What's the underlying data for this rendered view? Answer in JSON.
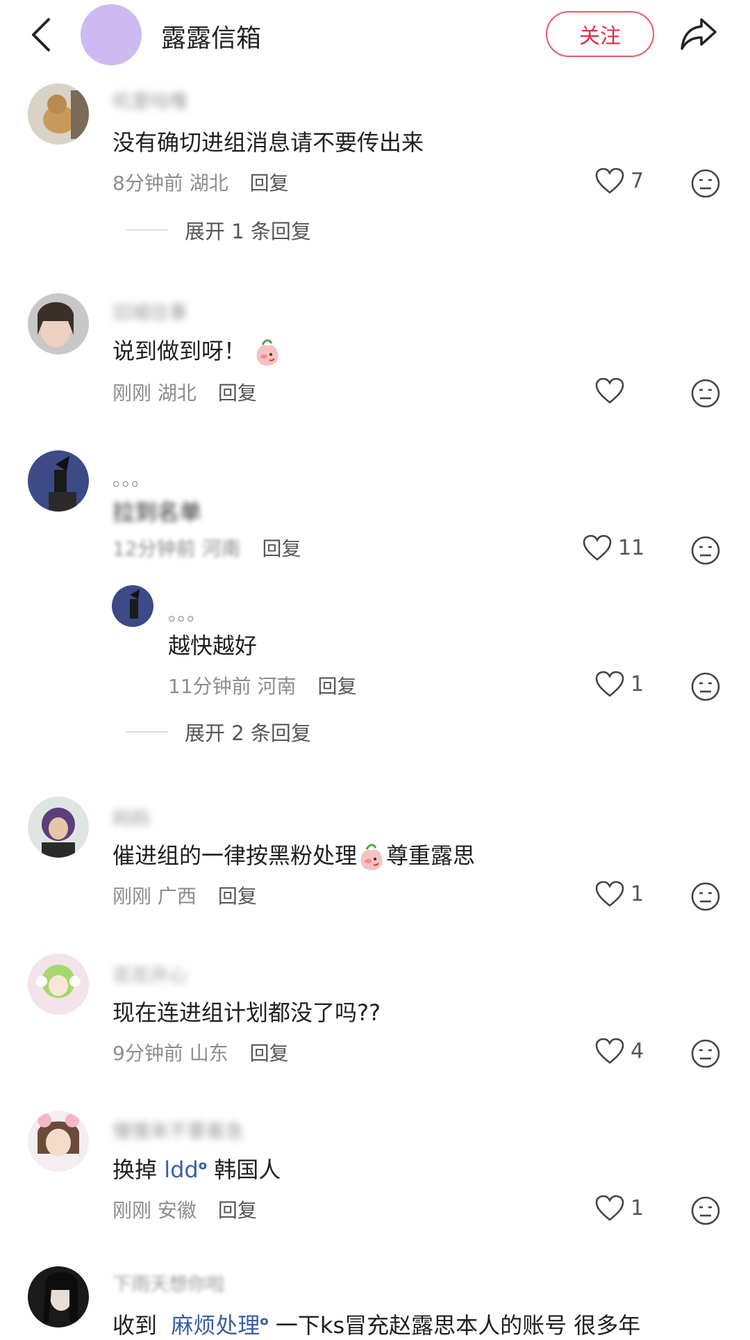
{
  "header": {
    "title": "露露信箱",
    "follow_label": "关注"
  },
  "comments": [
    {
      "username": "叽里咕噜",
      "text": "没有确切进组消息请不要传出来",
      "time": "8分钟前",
      "location": "湖北",
      "reply_label": "回复",
      "likes": "7",
      "expand_label": "展开 1 条回复"
    },
    {
      "username": "旧城往事",
      "text": "说到做到呀！",
      "time": "刚刚",
      "location": "湖北",
      "reply_label": "回复",
      "likes": ""
    },
    {
      "username": "。。。",
      "text": "拉到名单",
      "time": "12分钟前",
      "location": "河南",
      "reply_label": "回复",
      "likes": "11",
      "sub_reply": {
        "username": "。。。",
        "text": "越快越好",
        "time": "11分钟前",
        "location": "河南",
        "reply_label": "回复",
        "likes": "1"
      },
      "expand_label": "展开 2 条回复"
    },
    {
      "username": "妈妈",
      "text_before": "催进组的一律按黑粉处理",
      "text_after": "尊重露思",
      "time": "刚刚",
      "location": "广西",
      "reply_label": "回复",
      "likes": "1"
    },
    {
      "username": "花花开心",
      "text": "现在连进组计划都没了吗??",
      "time": "9分钟前",
      "location": "山东",
      "reply_label": "回复",
      "likes": "4"
    },
    {
      "username": "慢慢来不要着急",
      "text_before": "换掉",
      "link": "ldd",
      "text_after": "韩国人",
      "time": "刚刚",
      "location": "安徽",
      "reply_label": "回复",
      "likes": "1"
    },
    {
      "username": "下雨天想你啦",
      "text_before": "收到",
      "link": "麻烦处理",
      "text_after": "一下ks冒充赵露思本人的账号  很多年"
    }
  ],
  "icons": {
    "back": "back-arrow-icon",
    "share": "share-icon",
    "like": "heart-icon",
    "dislike": "neutral-face-icon",
    "emoji": "peach-kiss-emoji",
    "link": "search-magnifier-icon"
  },
  "colors": {
    "accent": "#e02d45",
    "link": "#3a5fa0",
    "meta": "#8c8c8c"
  }
}
